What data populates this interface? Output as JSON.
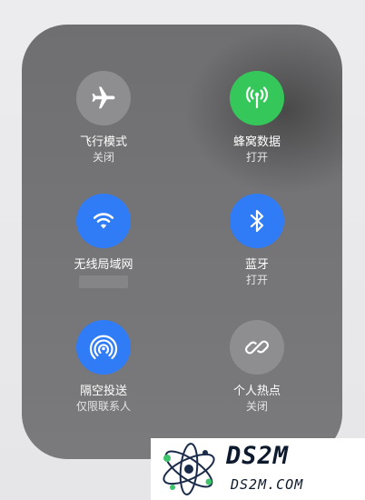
{
  "controls": [
    {
      "id": "airplane",
      "label": "飞行模式",
      "status": "关闭",
      "icon": "airplane-icon",
      "color": "#8e8e91"
    },
    {
      "id": "cellular",
      "label": "蜂窝数据",
      "status": "打开",
      "icon": "antenna-icon",
      "color": "#35c759"
    },
    {
      "id": "wifi",
      "label": "无线局域网",
      "status": "",
      "icon": "wifi-icon",
      "color": "#2f7cf6"
    },
    {
      "id": "bluetooth",
      "label": "蓝牙",
      "status": "打开",
      "icon": "bluetooth-icon",
      "color": "#2f7cf6"
    },
    {
      "id": "airdrop",
      "label": "隔空投送",
      "status": "仅限联系人",
      "icon": "airdrop-icon",
      "color": "#2f7cf6"
    },
    {
      "id": "hotspot",
      "label": "个人热点",
      "status": "关闭",
      "icon": "hotspot-link-icon",
      "color": "#8e8e91"
    }
  ],
  "watermark": {
    "title": "DS2M",
    "subtitle": "DS2M.COM",
    "icon": "atom-logo-icon"
  }
}
